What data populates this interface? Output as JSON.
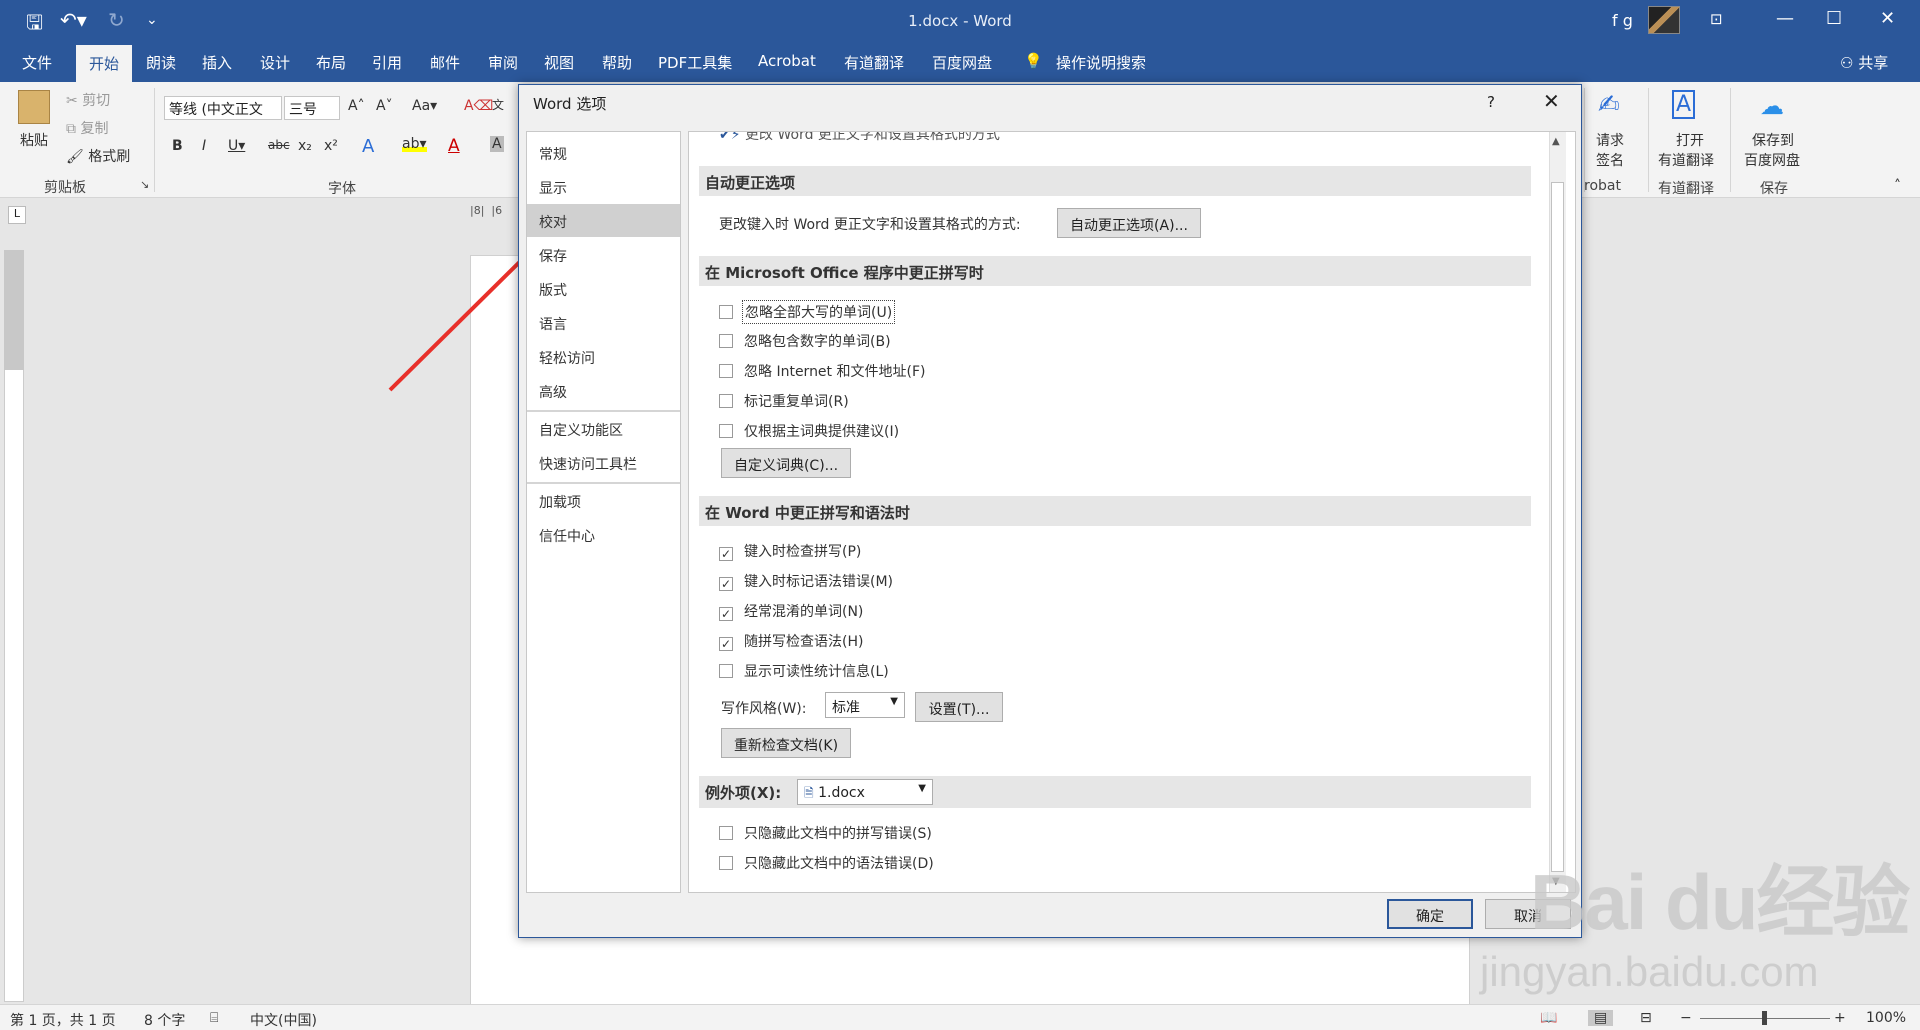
{
  "window": {
    "title": "1.docx  -  Word",
    "user": "f g"
  },
  "tabs": [
    "文件",
    "开始",
    "朗读",
    "插入",
    "设计",
    "布局",
    "引用",
    "邮件",
    "审阅",
    "视图",
    "帮助",
    "PDF工具集",
    "Acrobat",
    "有道翻译",
    "百度网盘"
  ],
  "tell_me": "操作说明搜索",
  "share": "共享",
  "clipboard": {
    "paste": "粘贴",
    "cut": "剪切",
    "copy": "复制",
    "format_painter": "格式刷",
    "group": "剪贴板"
  },
  "font": {
    "name": "等线 (中文正文",
    "size": "三号",
    "group": "字体"
  },
  "ribbon_right": {
    "request_sign_1": "请求",
    "request_sign_2": "签名",
    "acrobat_group": "robat",
    "open_youdao_1": "打开",
    "open_youdao_2": "有道翻译",
    "youdao_group": "有道翻译",
    "save_baidu_1": "保存到",
    "save_baidu_2": "百度网盘",
    "save_group": "保存"
  },
  "status": {
    "page": "第 1 页，共 1 页",
    "words": "8 个字",
    "lang": "中文(中国)",
    "zoom": "100%"
  },
  "dialog": {
    "title": "Word 选项",
    "help": "?",
    "nav": [
      "常规",
      "显示",
      "校对",
      "保存",
      "版式",
      "语言",
      "轻松访问",
      "高级",
      "自定义功能区",
      "快速访问工具栏",
      "加载项",
      "信任中心"
    ],
    "selected_nav": "校对",
    "top_partial_text": "更改 Word 更正文字和设置其格式的方式",
    "autocorrect_section": "自动更正选项",
    "autocorrect_desc": "更改键入时 Word 更正文字和设置其格式的方式:",
    "autocorrect_button": "自动更正选项(A)...",
    "office_section": "在 Microsoft Office 程序中更正拼写时",
    "office_options": [
      {
        "label": "忽略全部大写的单词(U)",
        "checked": false
      },
      {
        "label": "忽略包含数字的单词(B)",
        "checked": false
      },
      {
        "label": "忽略 Internet 和文件地址(F)",
        "checked": false
      },
      {
        "label": "标记重复单词(R)",
        "checked": false
      },
      {
        "label": "仅根据主词典提供建议(I)",
        "checked": false
      }
    ],
    "custom_dict_button": "自定义词典(C)...",
    "word_section": "在 Word 中更正拼写和语法时",
    "word_options": [
      {
        "label": "键入时检查拼写(P)",
        "checked": true
      },
      {
        "label": "键入时标记语法错误(M)",
        "checked": true
      },
      {
        "label": "经常混淆的单词(N)",
        "checked": true
      },
      {
        "label": "随拼写检查语法(H)",
        "checked": true
      },
      {
        "label": "显示可读性统计信息(L)",
        "checked": false
      }
    ],
    "writing_style_label": "写作风格(W):",
    "writing_style_value": "标准",
    "settings_button": "设置(T)...",
    "recheck_button": "重新检查文档(K)",
    "exceptions_label": "例外项(X):",
    "exceptions_file": "1.docx",
    "exception_options": [
      {
        "label": "只隐藏此文档中的拼写错误(S)",
        "checked": false
      },
      {
        "label": "只隐藏此文档中的语法错误(D)",
        "checked": false
      }
    ],
    "ok": "确定",
    "cancel": "取消"
  },
  "watermark": {
    "logo": "Bai du经验",
    "url": "jingyan.baidu.com"
  },
  "colors": {
    "accent": "#2b579a",
    "arrow": "#e8302a"
  }
}
